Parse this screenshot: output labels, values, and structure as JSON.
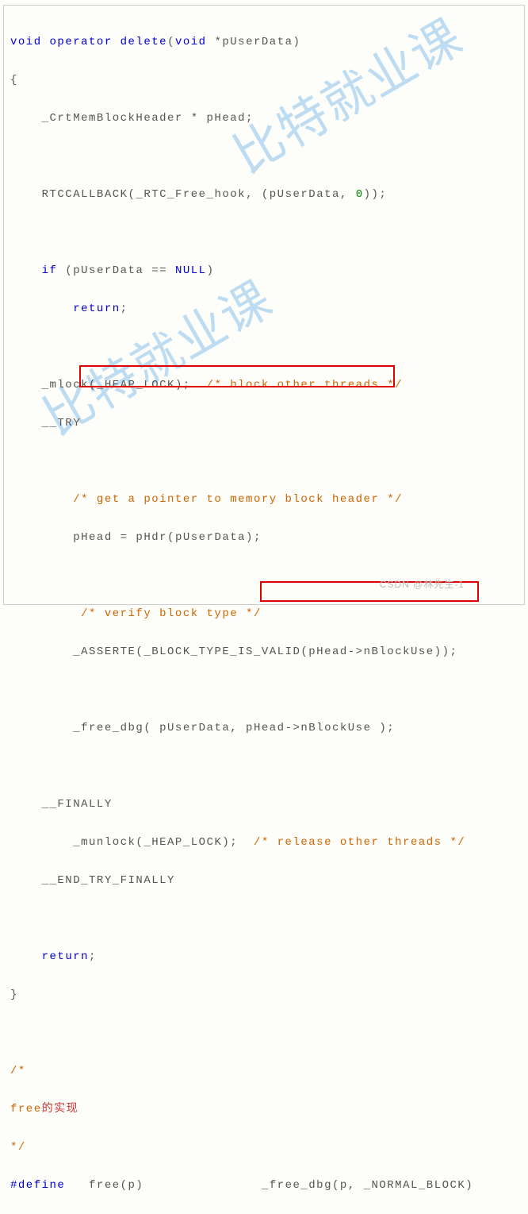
{
  "code": {
    "l1_kw1": "void",
    "l1_kw2": "operator",
    "l1_kw3": "delete",
    "l1_type": "void",
    "l1_param": " *pUserData",
    "l2": "{",
    "l3_a": "    _CrtMemBlockHeader * pHead",
    "l3_b": ";",
    "l5_a": "    RTCCALLBACK",
    "l5_b": "(",
    "l5_c": "_RTC_Free_hook",
    "l5_d": ", (",
    "l5_e": "pUserData",
    "l5_f": ", ",
    "l5_g": "0",
    "l5_h": "));",
    "l7_a": "    ",
    "l7_if": "if",
    "l7_b": " (",
    "l7_c": "pUserData",
    "l7_d": " == ",
    "l7_e": "NULL",
    "l7_f": ")",
    "l8_a": "        ",
    "l8_ret": "return",
    "l8_b": ";",
    "l10_a": "    _mlock(",
    "l10_b": "_HEAP_LOCK",
    "l10_c": ");  ",
    "l10_d": "/* block other threads */",
    "l11": "    __TRY",
    "l13": "        /* get a pointer to memory block header */",
    "l14_a": "        pHead ",
    "l14_b": "=",
    "l14_c": " pHdr(pUserData);",
    "l16": "         /* verify block type */",
    "l17_a": "        _ASSERTE(",
    "l17_b": "_BLOCK_TYPE_IS_VALID",
    "l17_c": "(pHead",
    "l17_d": "->",
    "l17_e": "nBlockUse));",
    "l19_a": "        ",
    "l19_b": "_free_dbg( pUserData, pHead",
    "l19_c": "->",
    "l19_d": "nBlockUse )",
    "l19_e": ";",
    "l21": "    __FINALLY",
    "l22_a": "        _munlock(",
    "l22_b": "_HEAP_LOCK",
    "l22_c": ");  ",
    "l22_d": "/* release other threads */",
    "l23": "    __END_TRY_FINALLY",
    "l25_a": "    ",
    "l25_ret": "return",
    "l25_b": ";",
    "l26": "}",
    "l28": "/*",
    "l29_a": "free",
    "l29_b": "的实现",
    "l30": "*/",
    "l31_a": "#define",
    "l31_b": "   free(p)               ",
    "l31_c": "_free_dbg(p, _NORMAL_BLOCK)"
  },
  "watermark": "比特就业课",
  "attribution": "CSDN @林先生-1"
}
